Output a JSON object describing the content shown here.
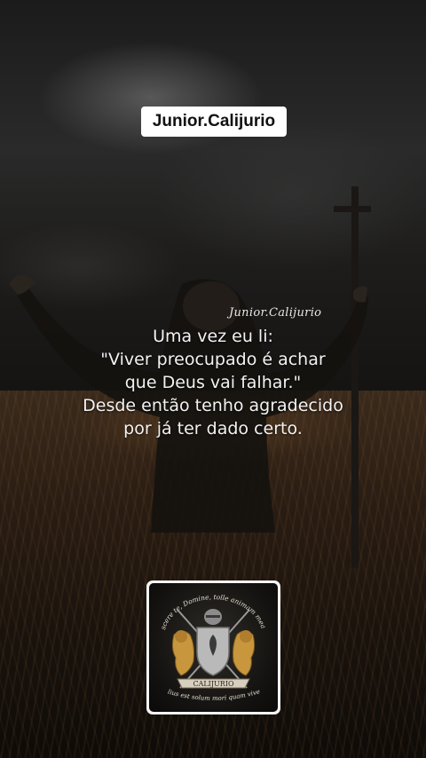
{
  "watermark": {
    "label": "Junior.Calijurio"
  },
  "signature": {
    "text": "Junior.Calijurio"
  },
  "quote": {
    "line1": "Uma vez eu li:",
    "line2": "\"Viver preocupado é achar",
    "line3": "que Deus vai falhar.\"",
    "line4": "Desde então tenho agradecido",
    "line5": "por já ter dado certo."
  },
  "crest": {
    "motto_top": "Discere te, Domine, tolle animam meam;",
    "banner": "CALIJURIO",
    "motto_bottom": "melius est solum mori quam vivere."
  },
  "colors": {
    "sky": "#1e1e1e",
    "field": "#2a1d13",
    "text": "#f2f2f2",
    "gold": "#c8963c"
  }
}
